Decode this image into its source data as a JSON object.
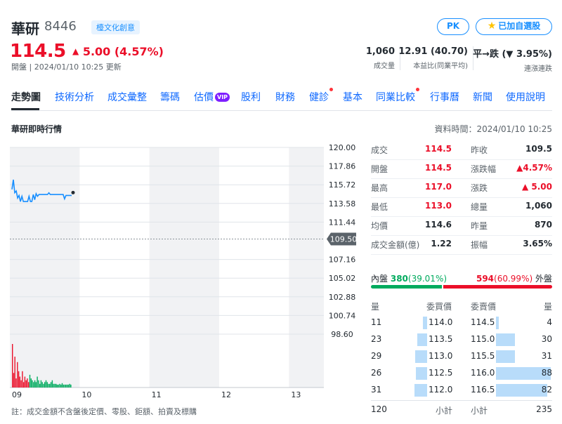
{
  "header": {
    "name": "華研",
    "code": "8446",
    "category": "檯文化創意",
    "pk_label": "PK",
    "fav_label": "已加自選股",
    "price": "114.5",
    "change": "5.00 (4.57%)",
    "market_time": "開盤 | 2024/01/10 10:25 更新",
    "stats": [
      {
        "value": "1,060",
        "label": "成交量"
      },
      {
        "value": "12.91 (40.70)",
        "label": "本益比(同業平均)"
      },
      {
        "value": "平→跌 (▼ 3.95%)",
        "label": "連漲連跌"
      }
    ]
  },
  "tabs": [
    {
      "label": "走勢圖",
      "active": true
    },
    {
      "label": "技術分析"
    },
    {
      "label": "成交彙整"
    },
    {
      "label": "籌碼"
    },
    {
      "label": "估價",
      "badge": "VIP"
    },
    {
      "label": "股利"
    },
    {
      "label": "財務"
    },
    {
      "label": "健診",
      "dot": true
    },
    {
      "label": "基本"
    },
    {
      "label": "同業比較",
      "dot": true
    },
    {
      "label": "行事曆"
    },
    {
      "label": "新聞"
    },
    {
      "label": "使用說明"
    }
  ],
  "section": {
    "title": "華研即時行情",
    "data_time": "資料時間：2024/01/10 10:25"
  },
  "chart_data": {
    "type": "line",
    "x_ticks": [
      "09",
      "10",
      "11",
      "12",
      "13"
    ],
    "y_ticks": [
      120.0,
      117.86,
      115.72,
      113.58,
      111.44,
      109.5,
      107.16,
      105.02,
      102.88,
      100.74,
      98.6
    ],
    "ylim": [
      98.6,
      120.0
    ],
    "reference_price": 109.5,
    "series": [
      {
        "values": [
          115.2,
          116.3,
          114.8,
          115.0,
          114.2,
          114.5,
          113.8,
          114.4,
          113.8,
          113.8,
          113.8,
          113.8,
          114.4,
          113.8,
          113.8,
          114.6,
          114.0,
          114.7,
          114.4,
          114.6,
          114.6,
          114.6,
          114.6,
          114.6,
          114.6,
          114.6,
          114.8,
          114.6,
          114.6,
          114.6,
          114.6,
          114.6,
          114.6,
          114.6,
          114.6,
          114.6,
          114.6,
          114.1,
          114.5,
          114.5,
          114.5,
          114.5,
          114.5
        ]
      }
    ],
    "volume": [
      120,
      40,
      85,
      25,
      70,
      45,
      30,
      20,
      45,
      15,
      30,
      20,
      25,
      15,
      35,
      25,
      20,
      15,
      20,
      15,
      30,
      20,
      10,
      20,
      15,
      10,
      15,
      20,
      15,
      10,
      10,
      15,
      20,
      10,
      10,
      10,
      8,
      8,
      10,
      8,
      12,
      8,
      8,
      8,
      8,
      8,
      10,
      8
    ],
    "up_color": "#eb0f29",
    "down_color": "#00ab5e",
    "line_color": "#188fff"
  },
  "footnote": "註：成交金額不含盤後定價、零股、鉅額、拍賣及標購",
  "quote": {
    "left": [
      {
        "label": "成交",
        "value": "114.5",
        "color": "red"
      },
      {
        "label": "開盤",
        "value": "114.5",
        "color": "red"
      },
      {
        "label": "最高",
        "value": "117.0",
        "color": "red"
      },
      {
        "label": "最低",
        "value": "113.0",
        "color": "red"
      },
      {
        "label": "均價",
        "value": "114.6",
        "color": "dark"
      },
      {
        "label": "成交金額(億)",
        "value": "1.22",
        "color": "dark"
      }
    ],
    "right": [
      {
        "label": "昨收",
        "value": "109.5",
        "color": "dark"
      },
      {
        "label": "漲跌幅",
        "value": "▲4.57%",
        "color": "red"
      },
      {
        "label": "漲跌",
        "value": "▲ 5.00",
        "color": "red"
      },
      {
        "label": "總量",
        "value": "1,060",
        "color": "dark"
      },
      {
        "label": "昨量",
        "value": "870",
        "color": "dark"
      },
      {
        "label": "振幅",
        "value": "3.65%",
        "color": "dark"
      }
    ]
  },
  "inout": {
    "in_label": "內盤",
    "in_value": "380",
    "in_pct": "(39.01%)",
    "in_ratio": 0.3901,
    "out_value": "594",
    "out_pct": "(60.99%)",
    "out_label": "外盤"
  },
  "book": {
    "headers": [
      "量",
      "委買價",
      "委賣價",
      "量"
    ],
    "bids": [
      {
        "vol": "11",
        "price": "114.0",
        "fill": 0.14
      },
      {
        "vol": "23",
        "price": "113.5",
        "fill": 0.3
      },
      {
        "vol": "29",
        "price": "113.0",
        "fill": 0.38
      },
      {
        "vol": "26",
        "price": "112.5",
        "fill": 0.34
      },
      {
        "vol": "31",
        "price": "112.0",
        "fill": 0.4
      }
    ],
    "asks": [
      {
        "vol": "4",
        "price": "114.5",
        "fill": 0.05
      },
      {
        "vol": "30",
        "price": "115.0",
        "fill": 0.34
      },
      {
        "vol": "31",
        "price": "115.5",
        "fill": 0.35
      },
      {
        "vol": "88",
        "price": "116.0",
        "fill": 1.0
      },
      {
        "vol": "82",
        "price": "116.5",
        "fill": 0.93
      }
    ],
    "footer": {
      "bid_total": "120",
      "bid_label": "小計",
      "ask_label": "小計",
      "ask_total": "235"
    }
  }
}
